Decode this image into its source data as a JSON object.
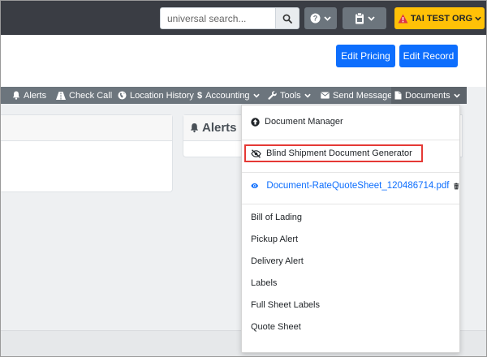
{
  "topbar": {
    "search": {
      "placeholder": "universal search..."
    },
    "org_label": "TAI TEST ORG"
  },
  "header": {
    "edit_pricing": "Edit Pricing",
    "edit_record": "Edit Record"
  },
  "tabs": [
    {
      "label": "Alerts",
      "icon": "bell-icon"
    },
    {
      "label": "Check Call",
      "icon": "road-icon"
    },
    {
      "label": "Location History",
      "icon": "globe-icon"
    },
    {
      "label": "Accounting",
      "icon": "dollar-icon"
    },
    {
      "label": "Tools",
      "icon": "wrench-icon"
    },
    {
      "label": "Send Message",
      "icon": "envelope-icon"
    },
    {
      "label": "Documents",
      "icon": "file-icon"
    }
  ],
  "alerts_panel": {
    "title": "Alerts"
  },
  "documents_menu": {
    "document_manager": "Document Manager",
    "blind_generator": "Blind Shipment Document Generator",
    "attached_file": "Document-RateQuoteSheet_120486714.pdf",
    "items": [
      "Bill of Lading",
      "Pickup Alert",
      "Delivery Alert",
      "Labels",
      "Full Sheet Labels",
      "Quote Sheet"
    ]
  },
  "colors": {
    "navbar": "#3a3d44",
    "primary": "#0d6efd",
    "warning": "#ffc107",
    "tabbar": "#6c757d",
    "highlight": "#e53935"
  }
}
